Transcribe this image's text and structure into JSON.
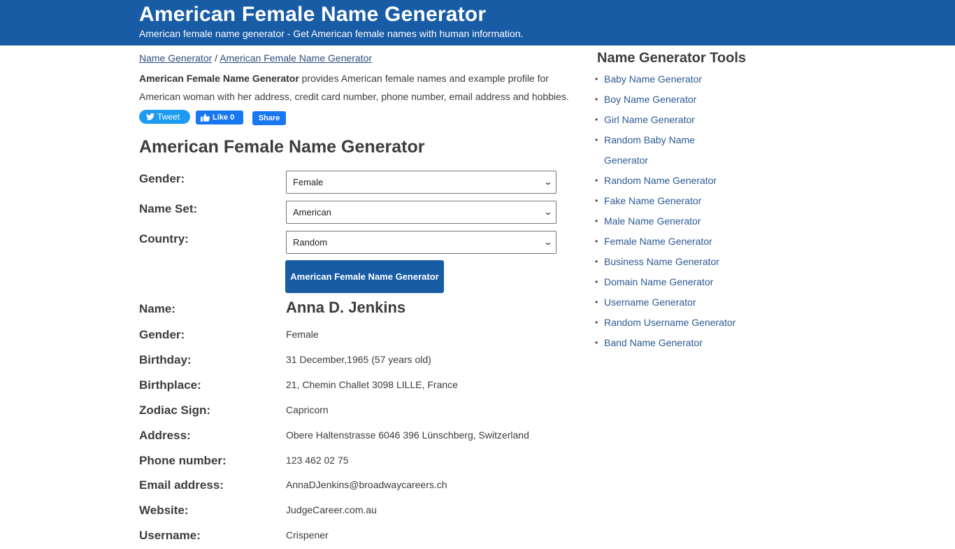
{
  "header": {
    "title": "American Female Name Generator",
    "subtitle": "American female name generator - Get American female names with human information."
  },
  "breadcrumb": {
    "items": [
      "Name Generator",
      "American Female Name Generator"
    ],
    "separator": "/"
  },
  "intro": {
    "bold": "American Female Name Generator",
    "text": " provides American female names and example profile for American woman with her address, credit card number, phone number, email address and hobbies."
  },
  "social": {
    "tweet_label": "Tweet",
    "like_label": "Like 0",
    "share_label": "Share"
  },
  "page_heading": "American Female Name Generator",
  "form": {
    "fields": [
      {
        "label": "Gender:",
        "value": "Female"
      },
      {
        "label": "Name Set:",
        "value": "American"
      },
      {
        "label": "Country:",
        "value": "Random"
      }
    ],
    "submit_label": "American Female Name Generator"
  },
  "profile": {
    "rows": [
      {
        "label": "Name:",
        "value": "Anna D. Jenkins"
      },
      {
        "label": "Gender:",
        "value": "Female"
      },
      {
        "label": "Birthday:",
        "value": "31 December,1965 (57 years old)"
      },
      {
        "label": "Birthplace:",
        "value": "21, Chemin Challet 3098 LILLE, France"
      },
      {
        "label": "Zodiac Sign:",
        "value": "Capricorn"
      },
      {
        "label": "Address:",
        "value": "Obere Haltenstrasse 6046 396 Lünschberg, Switzerland"
      },
      {
        "label": "Phone number:",
        "value": "123 462 02 75"
      },
      {
        "label": "Email address:",
        "value": "AnnaDJenkins@broadwaycareers.ch"
      },
      {
        "label": "Website:",
        "value": "JudgeCareer.com.au"
      },
      {
        "label": "Username:",
        "value": "Crispener"
      }
    ]
  },
  "sidebar": {
    "title": "Name Generator Tools",
    "items": [
      "Baby Name Generator",
      "Boy Name Generator",
      "Girl Name Generator",
      "Random Baby Name Generator",
      "Random Name Generator",
      "Fake Name Generator",
      "Male Name Generator",
      "Female Name Generator",
      "Business Name Generator",
      "Domain Name Generator",
      "Username Generator",
      "Random Username Generator",
      "Band Name Generator"
    ]
  },
  "colors": {
    "brand": "#185ca6",
    "link": "#2c5a94",
    "twitter": "#1d9bf0",
    "facebook": "#1877f2"
  }
}
